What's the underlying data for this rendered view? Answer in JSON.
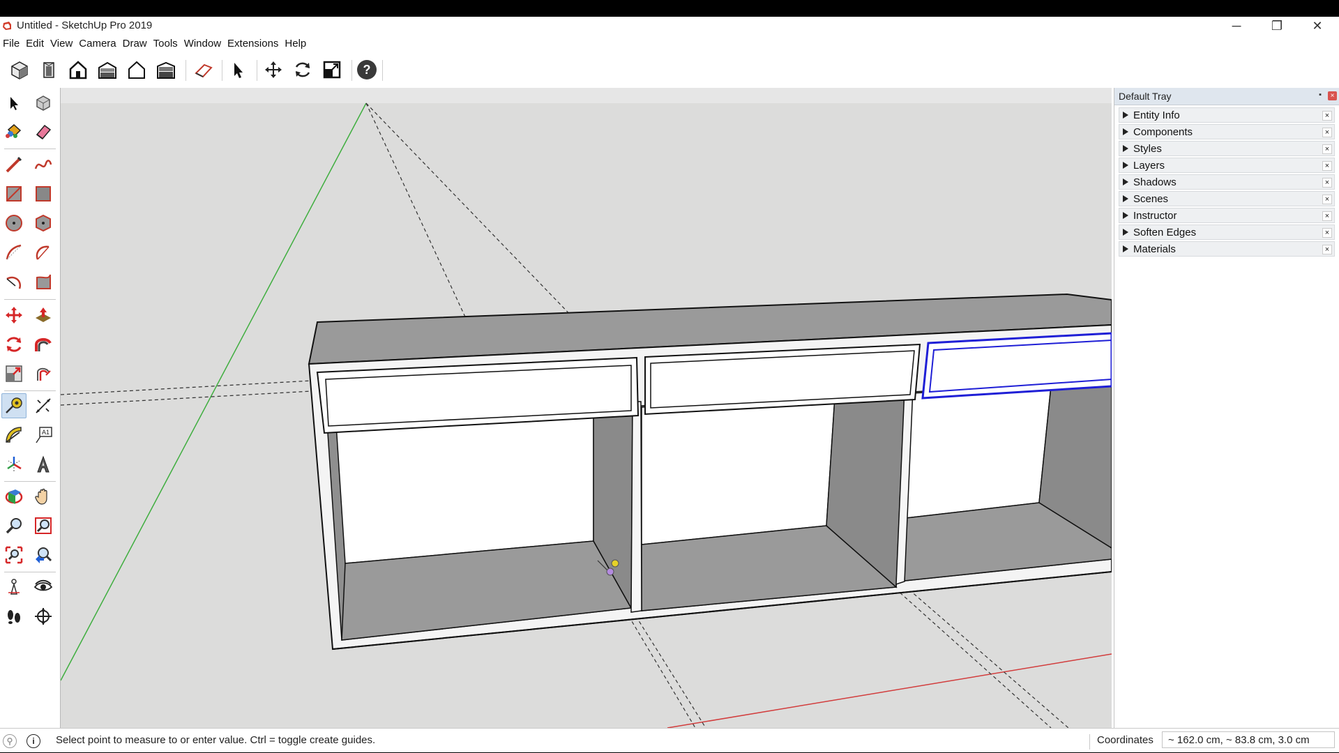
{
  "window": {
    "title": "Untitled - SketchUp Pro 2019",
    "minimize_glyph": "─",
    "restore_glyph": "❐",
    "close_glyph": "✕"
  },
  "menu": [
    "File",
    "Edit",
    "View",
    "Camera",
    "Draw",
    "Tools",
    "Window",
    "Extensions",
    "Help"
  ],
  "toolbar": {
    "icons": [
      "iso-view-icon",
      "top-view-icon",
      "front-view-icon",
      "right-view-icon",
      "back-view-icon",
      "left-view-icon",
      "section-plane-icon",
      "select-arrow-icon",
      "move-icon",
      "rotate-icon",
      "scale-icon",
      "help-icon"
    ]
  },
  "left_tools": {
    "icons": [
      "select-icon",
      "make-component-icon",
      "paint-bucket-icon",
      "eraser-icon",
      "line-icon",
      "freehand-icon",
      "rectangle-icon",
      "rotated-rectangle-icon",
      "circle-icon",
      "polygon-icon",
      "arc-icon",
      "two-point-arc-icon",
      "three-point-arc-icon",
      "pie-icon",
      "move-icon",
      "push-pull-icon",
      "rotate-icon",
      "follow-me-icon",
      "scale-icon",
      "offset-icon",
      "tape-measure-icon",
      "dimension-icon",
      "protractor-icon",
      "text-icon",
      "axes-icon",
      "3d-text-icon",
      "orbit-icon",
      "pan-icon",
      "zoom-icon",
      "zoom-window-icon",
      "zoom-extents-icon",
      "previous-view-icon",
      "position-camera-icon",
      "look-around-icon",
      "walk-icon",
      "section-plane-icon"
    ],
    "active": "tape-measure-icon"
  },
  "tray": {
    "title": "Default Tray",
    "panels": [
      "Entity Info",
      "Components",
      "Styles",
      "Layers",
      "Shadows",
      "Scenes",
      "Instructor",
      "Soften Edges",
      "Materials"
    ],
    "close_glyph": "×"
  },
  "status": {
    "message": "Select point to measure to or enter value.  Ctrl = toggle create guides.",
    "coord_label": "Coordinates",
    "coord_value": "~ 162.0 cm, ~ 83.8 cm, 3.0 cm"
  },
  "colors": {
    "viewport_bg": "#dcdcdb",
    "tray_header": "#dfe6ee",
    "selection_blue": "#1f1fd6",
    "axis_green": "#3fae3f",
    "axis_red": "#d23c3c"
  }
}
